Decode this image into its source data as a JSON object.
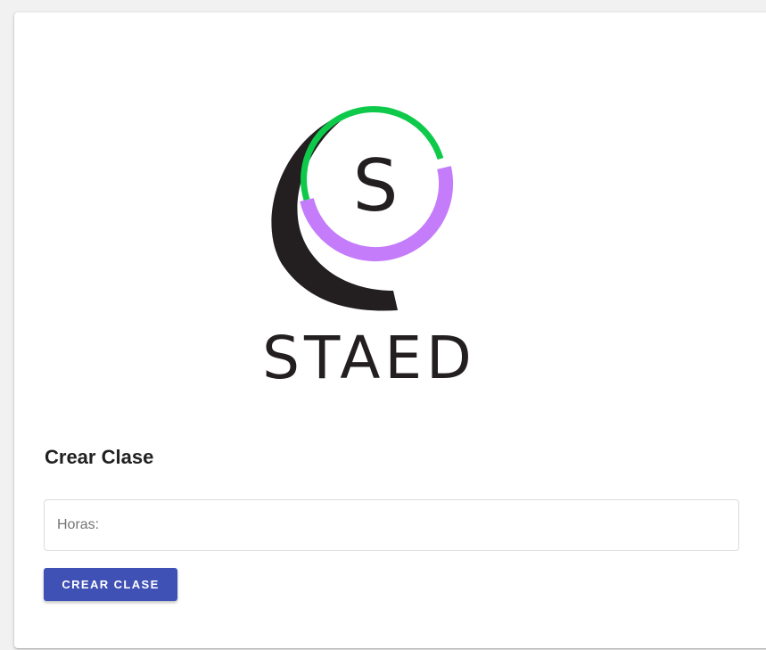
{
  "logo": {
    "icon_letter": "S",
    "wordmark": "STAED",
    "colors": {
      "dark": "#231f20",
      "green": "#0ec94a",
      "purple": "#c47cfa"
    }
  },
  "form": {
    "title": "Crear Clase",
    "hours_field": {
      "placeholder": "Horas:",
      "value": ""
    },
    "submit_button": {
      "label": "CREAR CLASE",
      "color": "#3f51b5"
    }
  }
}
